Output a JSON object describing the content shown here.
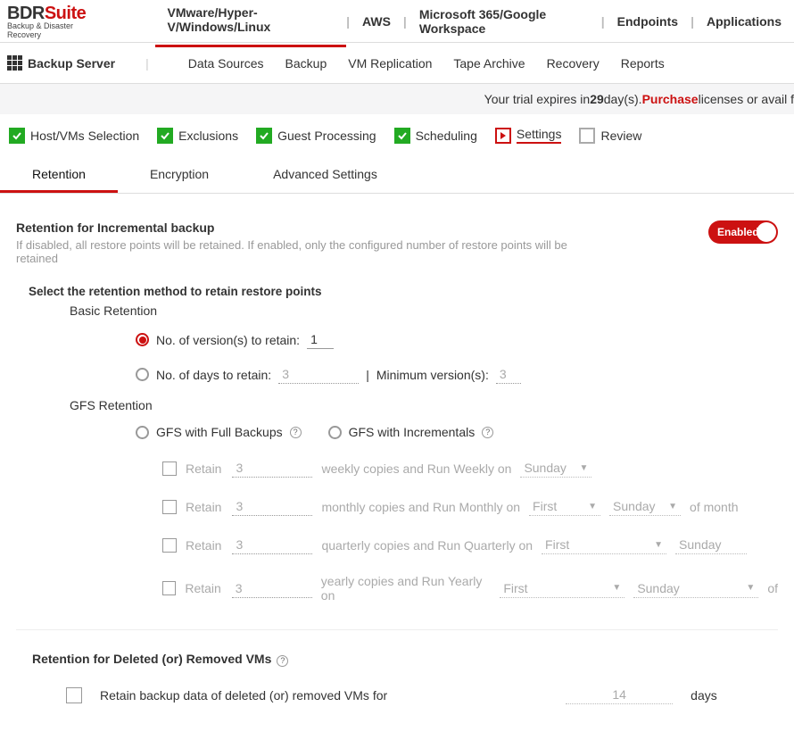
{
  "logo": {
    "main1": "BDR",
    "main2": "Suite",
    "sub": "Backup & Disaster Recovery"
  },
  "products": {
    "p0": "VMware/Hyper-V/Windows/Linux",
    "p1": "AWS",
    "p2": "Microsoft 365/Google Workspace",
    "p3": "Endpoints",
    "p4": "Applications"
  },
  "nav": {
    "server": "Backup Server",
    "i0": "Data Sources",
    "i1": "Backup",
    "i2": "VM Replication",
    "i3": "Tape Archive",
    "i4": "Recovery",
    "i5": "Reports"
  },
  "trial": {
    "prefix": "Your trial expires in ",
    "days": "29",
    "mid": " day(s). ",
    "purchase": "Purchase",
    "suffix": " licenses or avail f"
  },
  "steps": {
    "s0": "Host/VMs Selection",
    "s1": "Exclusions",
    "s2": "Guest Processing",
    "s3": "Scheduling",
    "s4": "Settings",
    "s5": "Review"
  },
  "subtabs": {
    "t0": "Retention",
    "t1": "Encryption",
    "t2": "Advanced Settings"
  },
  "retention": {
    "title": "Retention for Incremental backup",
    "desc": "If disabled, all restore points will be retained. If enabled, only the configured number of restore points will be retained",
    "toggle": "Enabled",
    "select_method": "Select the retention method to retain restore points",
    "basic": "Basic Retention",
    "versions_label": "No. of version(s) to retain:",
    "versions_val": "1",
    "days_label": "No. of days to retain:",
    "days_val": "3",
    "sep": "|",
    "min_label": "Minimum version(s):",
    "min_val": "3",
    "gfs": "GFS Retention",
    "gfs_full": "GFS with Full Backups",
    "gfs_inc": "GFS with Incrementals",
    "retain_word": "Retain",
    "three": "3",
    "weekly_txt": "weekly copies and Run Weekly on",
    "monthly_txt": "monthly copies and Run Monthly on",
    "quarterly_txt": "quarterly copies and Run Quarterly on",
    "yearly_txt": "yearly copies and Run Yearly on",
    "sunday": "Sunday",
    "first": "First",
    "of_month": "of month",
    "of": "of"
  },
  "deleted": {
    "title": "Retention for Deleted (or) Removed VMs",
    "row": "Retain backup data of deleted (or) removed VMs for",
    "val": "14",
    "unit": "days"
  }
}
